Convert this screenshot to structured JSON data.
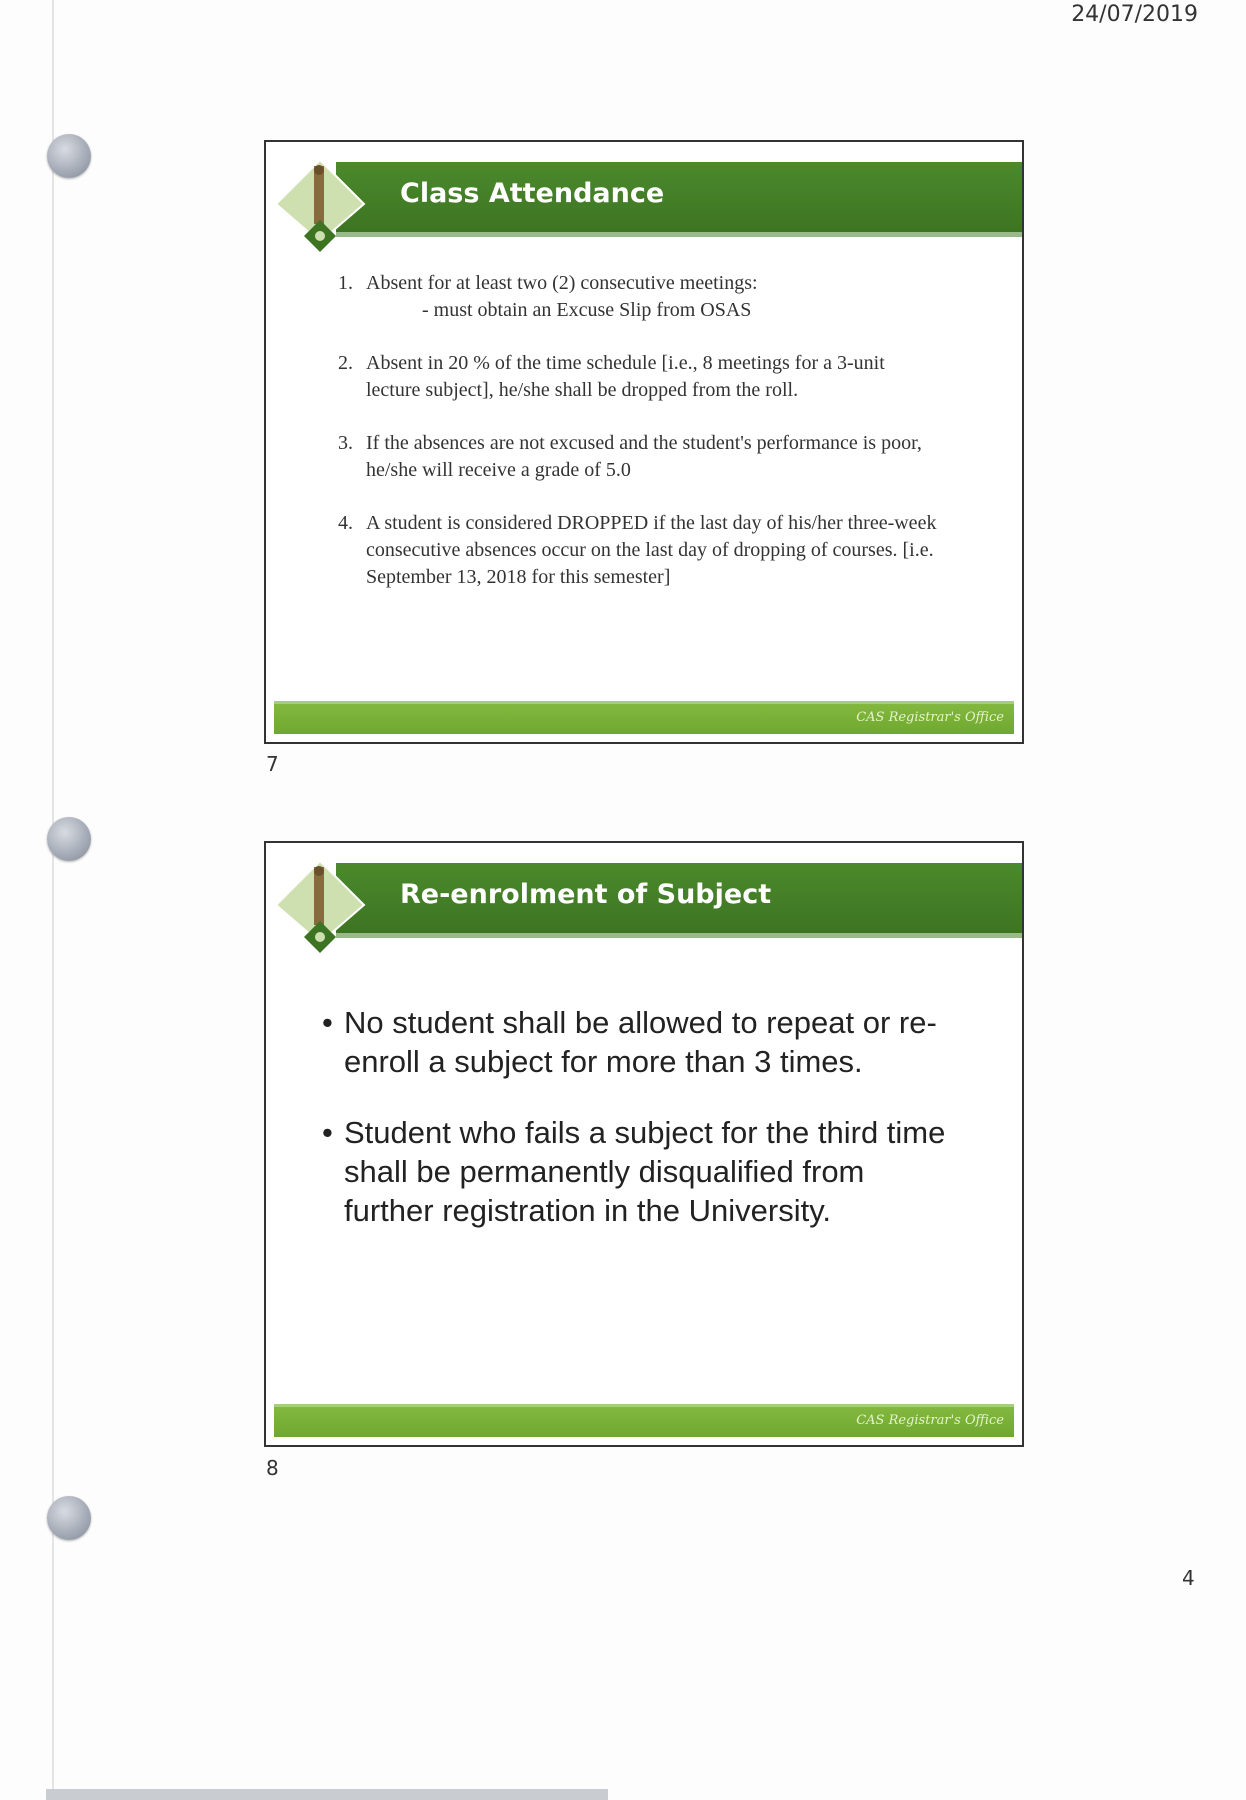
{
  "page": {
    "date": "24/07/2019",
    "page_number": "4"
  },
  "slides": [
    {
      "number": "7",
      "title": "Class Attendance",
      "footer": "CAS Registrar's Office",
      "items": [
        {
          "n": "1.",
          "text": "Absent for at least two (2) consecutive meetings:",
          "sub": "- must obtain an Excuse Slip from OSAS"
        },
        {
          "n": "2.",
          "text": "Absent in 20 % of the time schedule [i.e., 8 meetings for a 3-unit lecture subject], he/she shall be dropped from the roll."
        },
        {
          "n": "3.",
          "text": "If the absences are not excused and the student's performance is poor, he/she will receive a grade of 5.0"
        },
        {
          "n": "4.",
          "text": "A student is considered DROPPED if the last day of his/her three-week consecutive absences occur on the last day of dropping of courses. [i.e. September 13, 2018 for this semester]"
        }
      ]
    },
    {
      "number": "8",
      "title": "Re-enrolment of Subject",
      "footer": "CAS Registrar's Office",
      "bullet": "•",
      "items": [
        "No student shall be allowed to repeat or re-enroll a subject for more than 3 times.",
        "Student who fails a subject for the third time shall be permanently disqualified from further registration in the University."
      ]
    }
  ]
}
